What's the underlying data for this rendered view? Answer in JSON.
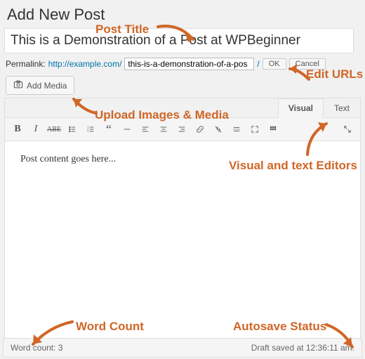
{
  "page_title": "Add New Post",
  "title_input": "This is a Demonstration of a Post at WPBeginner",
  "permalink": {
    "label": "Permalink:",
    "base": "http://example.com/",
    "slug": "this-is-a-demonstration-of-a-pos",
    "tail": "/",
    "ok": "OK",
    "cancel": "Cancel"
  },
  "add_media": "Add Media",
  "tabs": {
    "visual": "Visual",
    "text": "Text"
  },
  "content": "Post content goes here...",
  "status": {
    "word_count_label": "Word count: ",
    "word_count_value": "3",
    "autosave": "Draft saved at 12:36:11 am."
  },
  "annotations": {
    "post_title": "Post Title",
    "edit_urls": "Edit URLs",
    "upload": "Upload Images & Media",
    "editors": "Visual and text Editors",
    "word_count": "Word Count",
    "autosave": "Autosave Status"
  }
}
